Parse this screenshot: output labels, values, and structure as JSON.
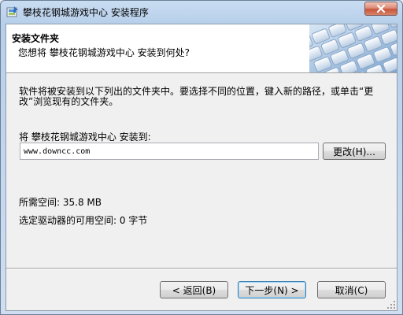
{
  "window": {
    "title": "攀枝花钢城游戏中心 安装程序",
    "icons": {
      "app": "installer-icon",
      "close": "close-icon"
    }
  },
  "header": {
    "title": "安装文件夹",
    "subtitle": "您想将 攀枝花钢城游戏中心 安装到何处?",
    "image": "keyboard-image"
  },
  "body": {
    "intro": "软件将被安装到以下列出的文件夹中。要选择不同的位置，键入新的路径，或单击“更改”浏览现有的文件夹。",
    "dest_label": "将 攀枝花钢城游戏中心 安装到:",
    "dest_path": "www.downcc.com",
    "change_button": "更改(H)...",
    "space_required": "所需空间: 35.8 MB",
    "space_available": "选定驱动器的可用空间: 0 字节"
  },
  "footer": {
    "back_button": "< 返回(B)",
    "next_button": "下一步(N) >",
    "cancel_button": "取消(C)"
  },
  "colors": {
    "titlebar": "#c9dcf2",
    "dialog_bg": "#f0f0f0",
    "close_red": "#c9543a",
    "default_border": "#3c7fb1"
  }
}
